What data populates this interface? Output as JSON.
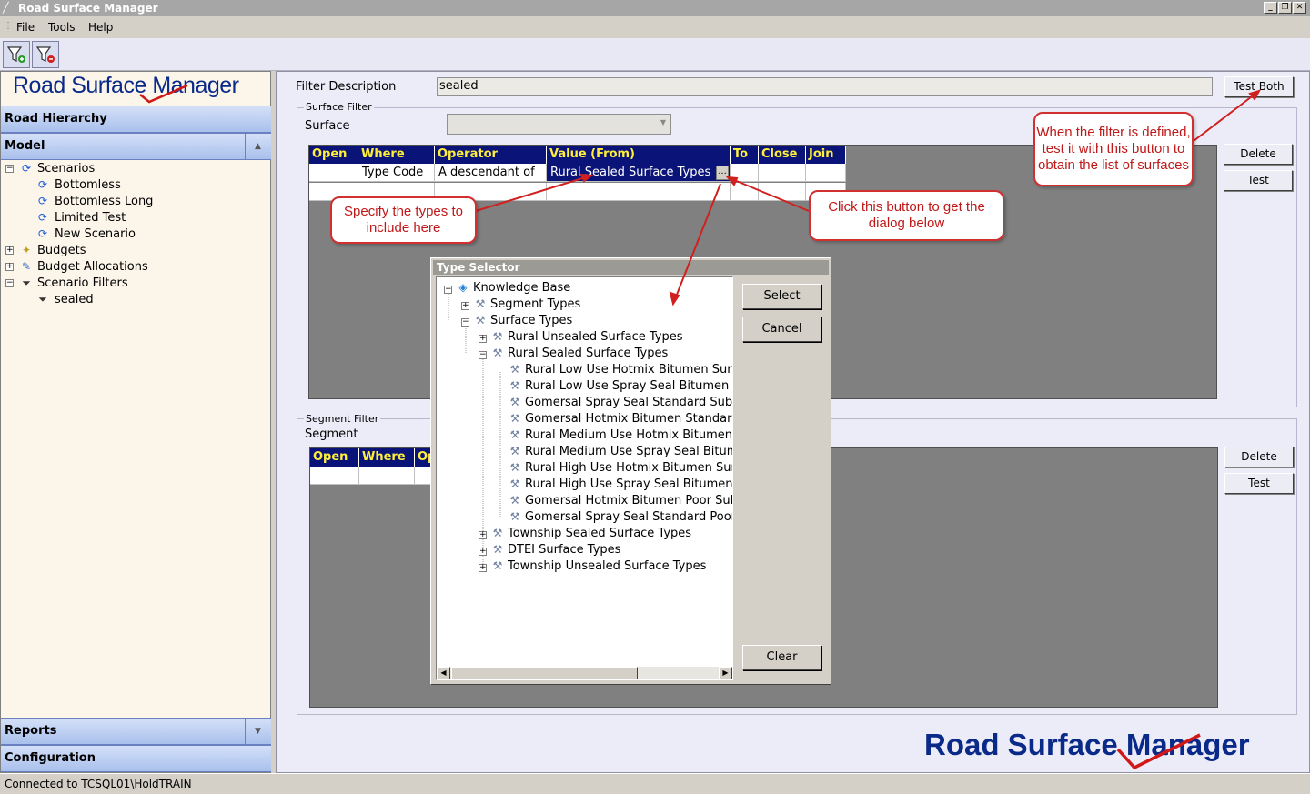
{
  "window": {
    "title": "Road Surface Manager"
  },
  "menu": [
    "File",
    "Tools",
    "Help"
  ],
  "logo": {
    "text": "Road Surface Manager"
  },
  "nav": {
    "road_hierarchy": "Road Hierarchy",
    "model": "Model",
    "reports": "Reports",
    "configuration": "Configuration"
  },
  "tree": {
    "scenarios": "Scenarios",
    "scenario_items": [
      "Bottomless",
      "Bottomless Long",
      "Limited Test",
      "New Scenario"
    ],
    "budgets": "Budgets",
    "budget_allocations": "Budget Allocations",
    "scenario_filters": "Scenario Filters",
    "filter_items": [
      "sealed"
    ]
  },
  "main": {
    "filter_description_label": "Filter Description",
    "filter_description_value": "sealed",
    "test_both": "Test Both",
    "surface_filter": {
      "group_label": "Surface Filter",
      "field_label": "Surface",
      "columns": [
        "Open",
        "Where",
        "Operator",
        "Value (From)",
        "To",
        "Close",
        "Join"
      ],
      "row": {
        "where": "Type Code",
        "operator": "A descendant of",
        "value": "Rural Sealed Surface Types",
        "ellipsis": "..."
      },
      "delete": "Delete",
      "test": "Test"
    },
    "segment_filter": {
      "group_label": "Segment Filter",
      "field_label": "Segment",
      "columns": [
        "Open",
        "Where",
        "Op"
      ],
      "delete": "Delete",
      "test": "Test"
    }
  },
  "callouts": {
    "test_both": "When the filter is defined, test it with this button to obtain the list of surfaces",
    "specify": "Specify the types to include here",
    "click": "Click this button to get the dialog below"
  },
  "dialog": {
    "title": "Type Selector",
    "root": "Knowledge Base",
    "segment_types": "Segment Types",
    "surface_types": "Surface Types",
    "rural_unsealed": "Rural Unsealed Surface Types",
    "rural_sealed": "Rural Sealed Surface Types",
    "sealed_children": [
      "Rural Low Use Hotmix Bitumen Surface",
      "Rural Low Use Spray Seal Bitumen Su",
      "Gomersal Spray Seal Standard Subgra",
      "Gomersal Hotmix Bitumen Standard Su",
      "Rural Medium Use Hotmix Bitumen Sur",
      "Rural Medium Use Spray Seal Bitumen",
      "Rural High Use Hotmix Bitumen Surfac",
      "Rural High Use Spray Seal Bitumen Su",
      "Gomersal Hotmix Bitumen Poor Subgra",
      "Gomersal Spray Seal Standard Poor S"
    ],
    "township_sealed": "Township Sealed Surface Types",
    "dtei": "DTEI Surface Types",
    "township_unsealed": "Township Unsealed Surface Types",
    "select": "Select",
    "cancel": "Cancel",
    "clear": "Clear"
  },
  "status": {
    "text": "Connected to TCSQL01\\HoldTRAIN"
  }
}
